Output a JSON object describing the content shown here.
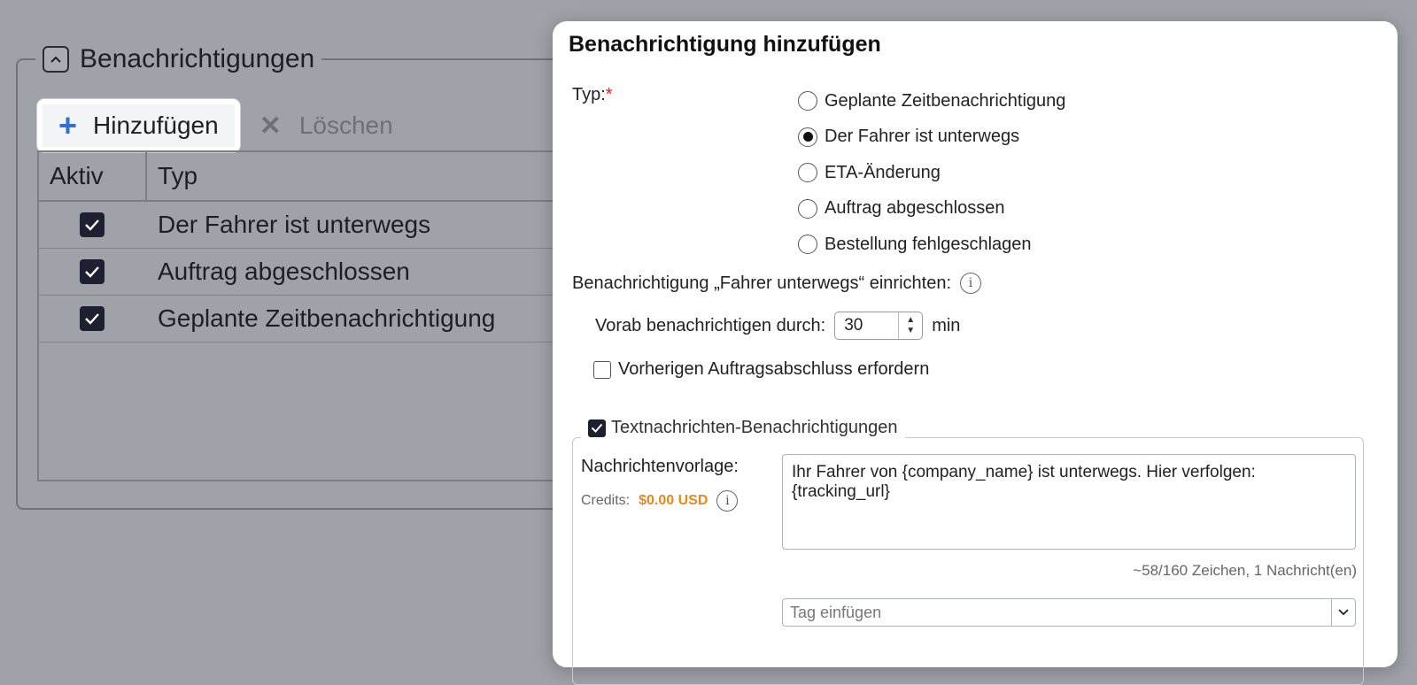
{
  "background": {
    "section_title": "Benachrichtigungen",
    "toolbar": {
      "add_label": "Hinzufügen",
      "delete_label": "Löschen"
    },
    "table": {
      "headers": [
        "Aktiv",
        "Typ"
      ],
      "rows": [
        {
          "active": true,
          "type": "Der Fahrer ist unterwegs"
        },
        {
          "active": true,
          "type": "Auftrag abgeschlossen"
        },
        {
          "active": true,
          "type": "Geplante Zeitbenachrichtigung"
        }
      ]
    }
  },
  "dialog": {
    "title": "Benachrichtigung hinzufügen",
    "type_label": "Typ:",
    "required_marker": "*",
    "type_options": [
      {
        "label": "Geplante Zeitbenachrichtigung",
        "selected": false
      },
      {
        "label": "Der Fahrer ist unterwegs",
        "selected": true
      },
      {
        "label": "ETA-Änderung",
        "selected": false
      },
      {
        "label": "Auftrag abgeschlossen",
        "selected": false
      },
      {
        "label": "Bestellung fehlgeschlagen",
        "selected": false
      }
    ],
    "setup_label": "Benachrichtigung „Fahrer unterwegs“ einrichten:",
    "notify_ahead_label": "Vorab benachrichtigen durch:",
    "notify_ahead_value": "30",
    "notify_ahead_unit": "min",
    "require_previous_label": "Vorherigen Auftragsabschluss erfordern",
    "require_previous_checked": false,
    "sms": {
      "legend": "Textnachrichten-Benachrichtigungen",
      "enabled": true,
      "template_label": "Nachrichtenvorlage:",
      "credits_label": "Credits:",
      "credits_value": "$0.00 USD",
      "template_text": "Ihr Fahrer von {company_name} ist unterwegs. Hier verfolgen: {tracking_url}",
      "char_count": "~58/160 Zeichen, 1 Nachricht(en)",
      "tag_placeholder": "Tag einfügen"
    }
  },
  "colors": {
    "accent_blue": "#2f6fd6",
    "credits_orange": "#e8891d",
    "required_red": "#dd2222"
  }
}
